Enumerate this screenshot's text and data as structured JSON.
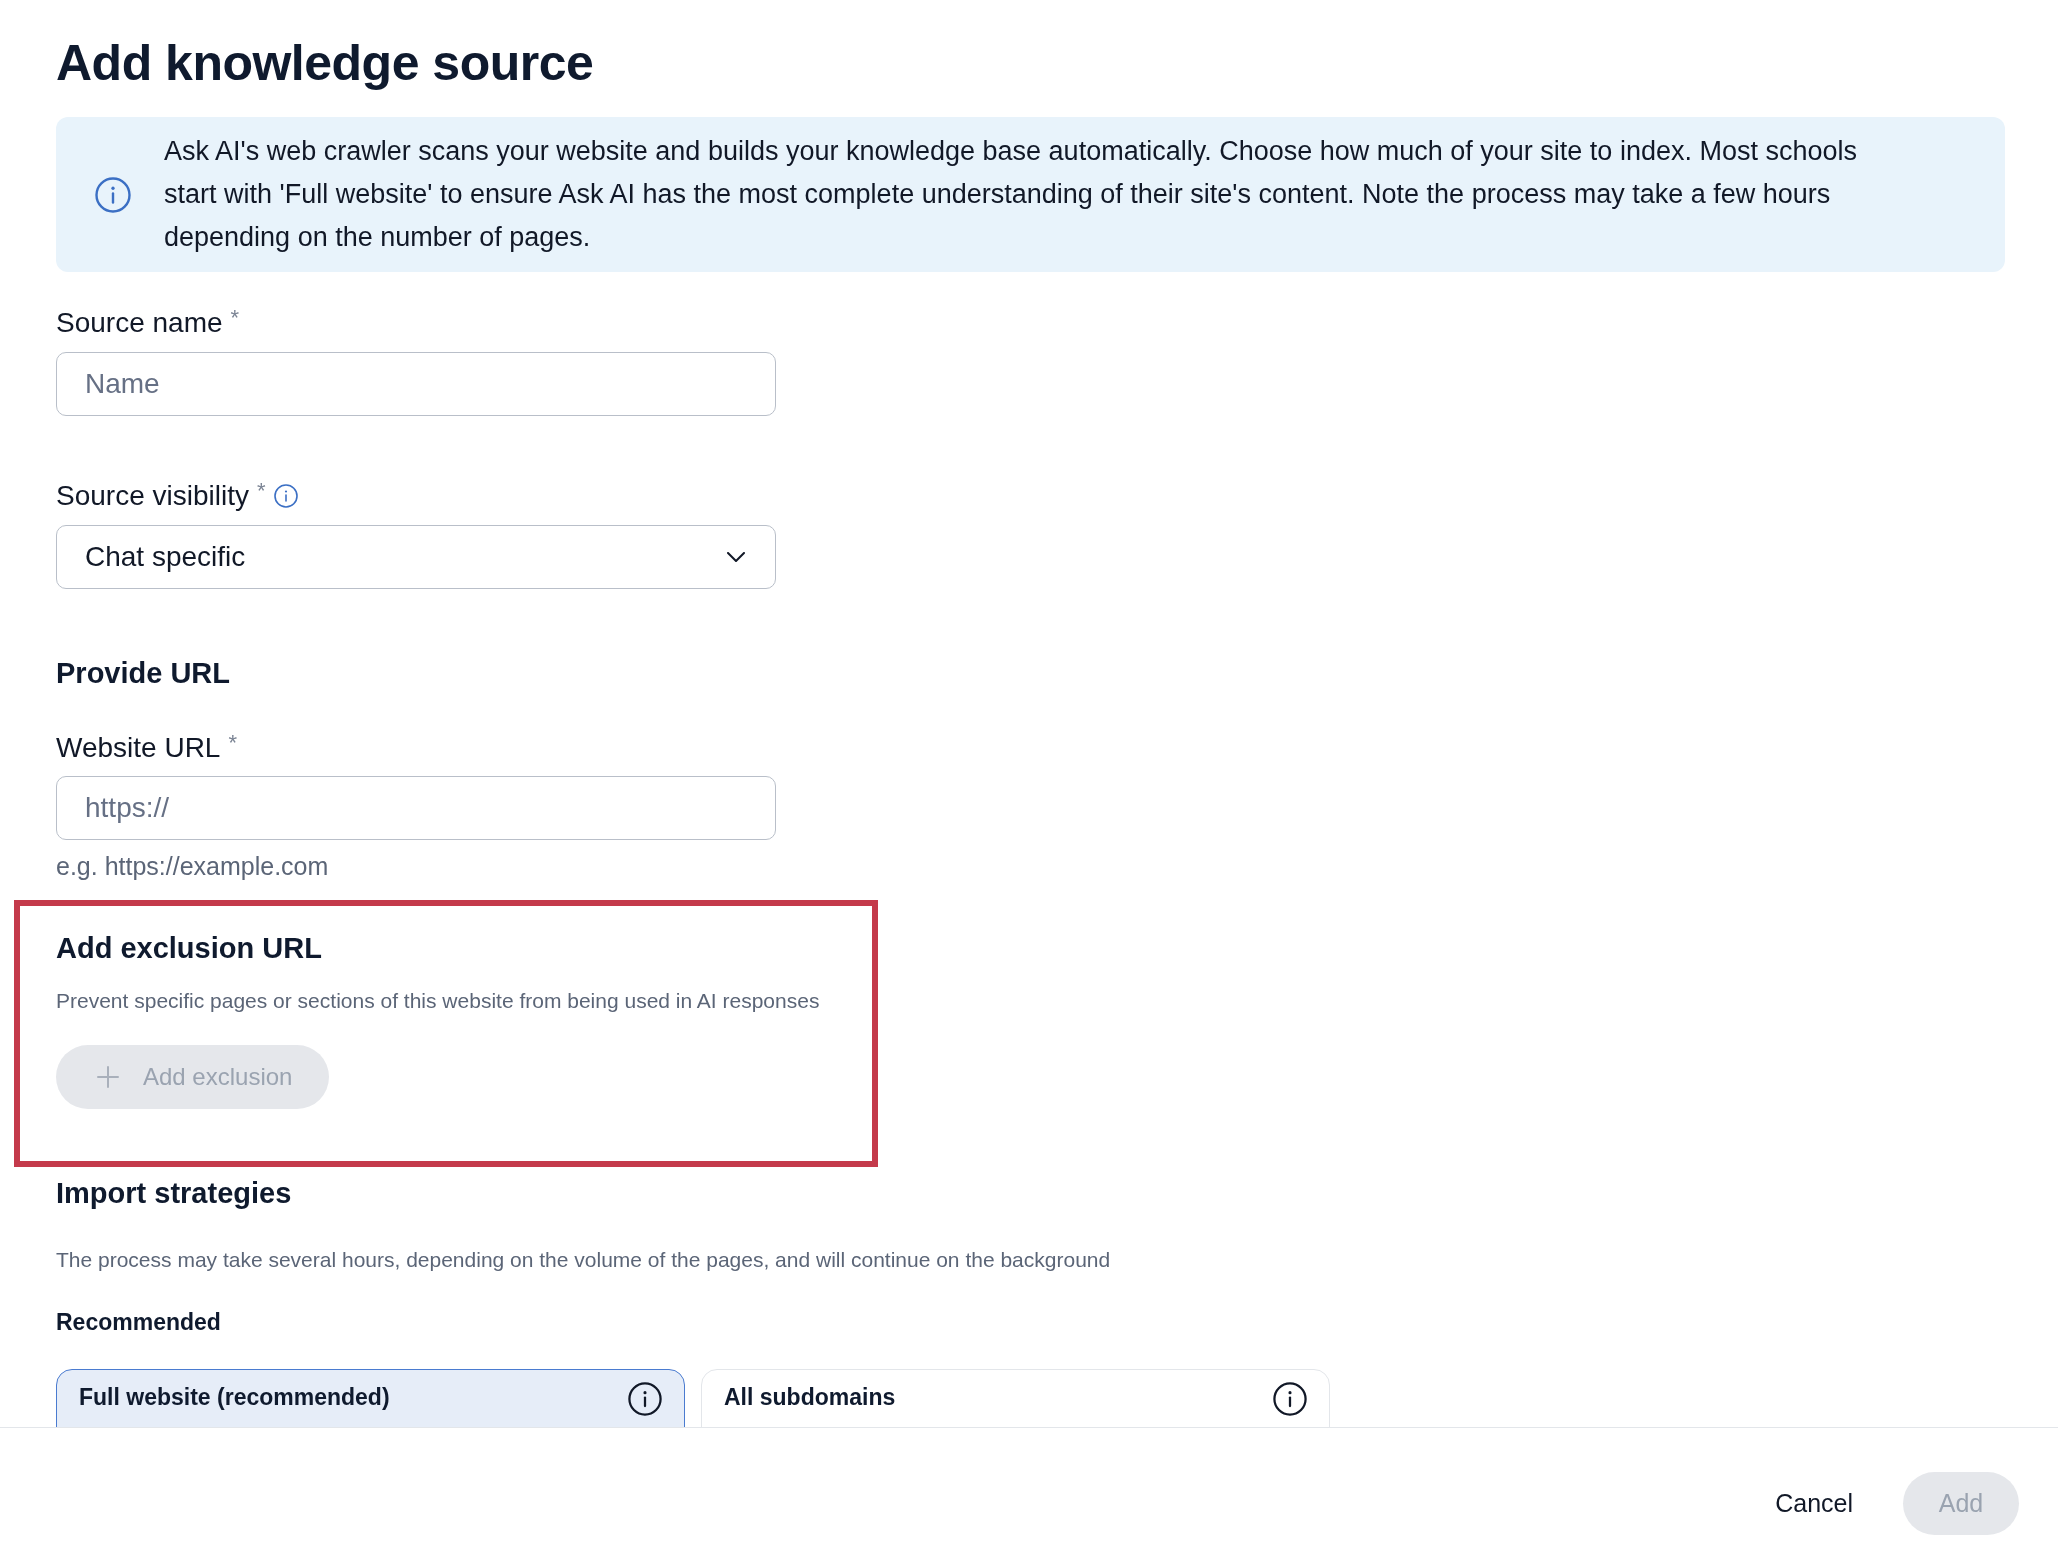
{
  "page": {
    "title": "Add knowledge source"
  },
  "info_banner": {
    "text": "Ask AI's web crawler scans your website and builds your knowledge base automatically. Choose how much of your site to index. Most schools start with 'Full website' to ensure Ask AI has the most complete understanding of their site's content. Note the process may take a few hours depending on the number of pages."
  },
  "fields": [
    {
      "kind": "text",
      "label": "Source name",
      "required_mark": "*",
      "placeholder": "Name"
    },
    {
      "kind": "select",
      "label": "Source visibility",
      "required_mark": "*",
      "info_icon": true,
      "value": "Chat specific"
    }
  ],
  "provide_url": {
    "title": "Provide URL",
    "field": {
      "label": "Website URL",
      "required_mark": "*",
      "placeholder": "https://",
      "hint": "e.g. https://example.com"
    }
  },
  "exclusion": {
    "highlighted": true,
    "title": "Add exclusion URL",
    "description": "Prevent specific pages or sections of this website from being used in AI responses",
    "button": {
      "label": "Add exclusion",
      "disabled": true
    }
  },
  "import_strategies": {
    "title": "Import strategies",
    "description": "The process may take several hours, depending on the volume of the pages, and will continue on the background",
    "group_label": "Recommended",
    "options": [
      {
        "label": "Full website (recommended)",
        "selected": true
      },
      {
        "label": "All subdomains",
        "selected": false
      }
    ]
  },
  "footer": {
    "buttons": [
      {
        "kind": "text",
        "label": "Cancel",
        "disabled": false
      },
      {
        "kind": "primary",
        "label": "Add",
        "disabled": true
      }
    ]
  }
}
